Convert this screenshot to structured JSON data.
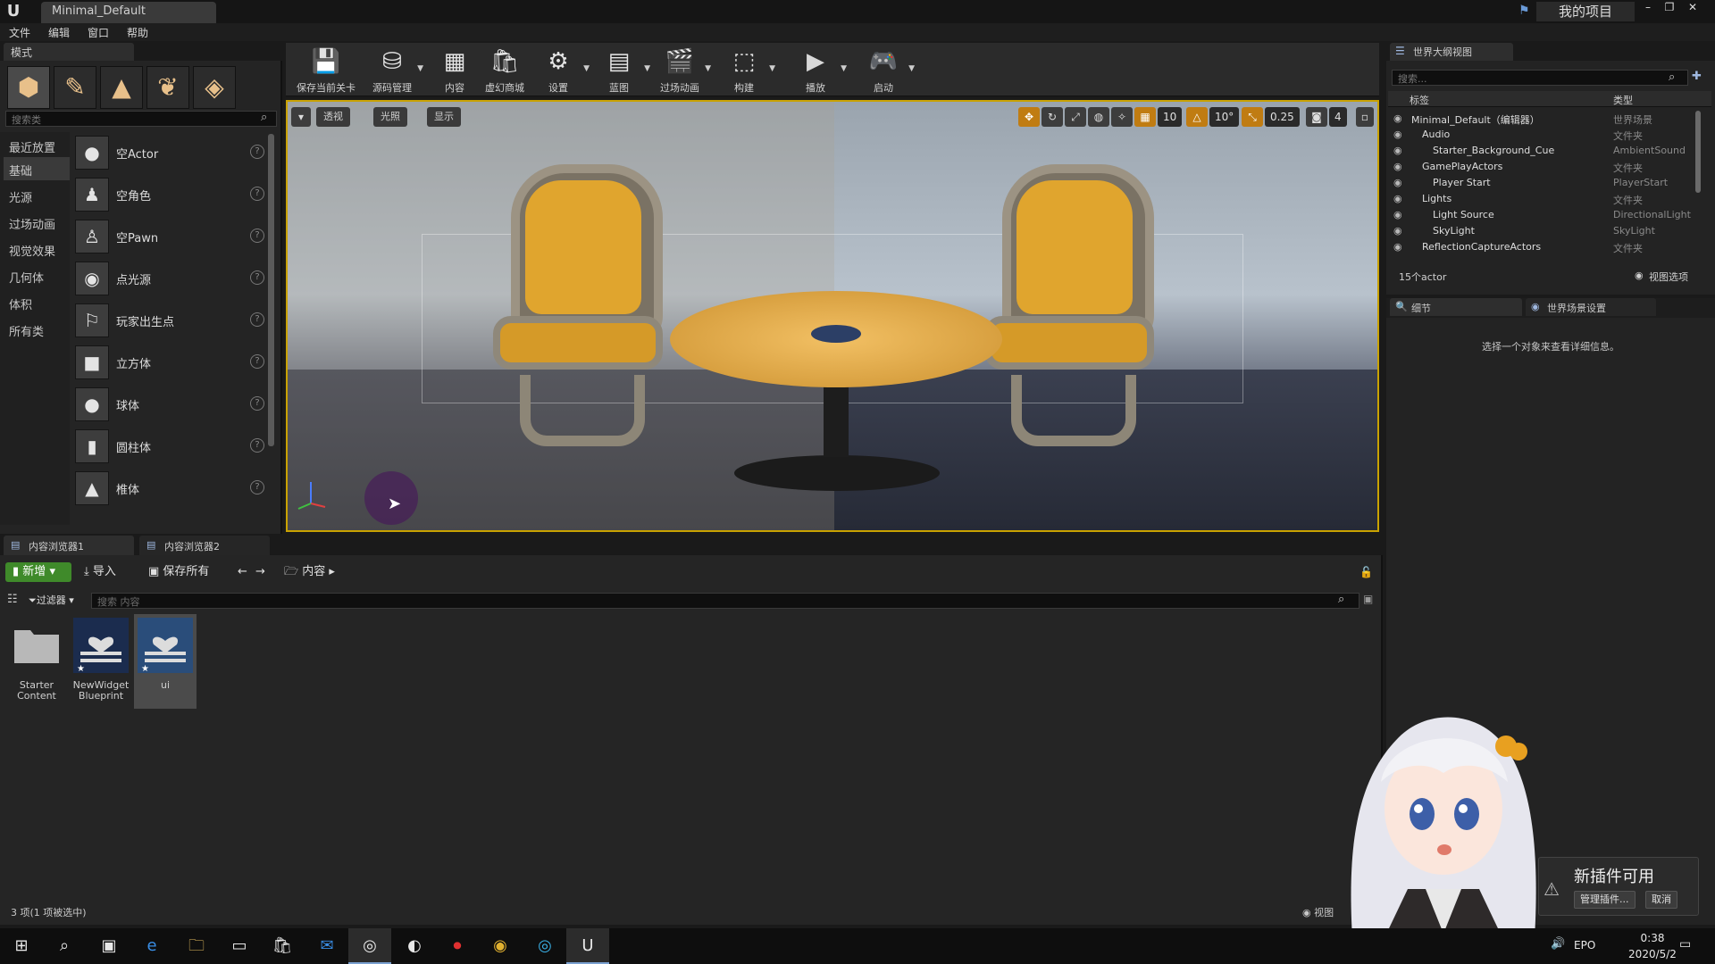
{
  "window": {
    "tab_title": "Minimal_Default",
    "my_project": "我的项目"
  },
  "menu": [
    "文件",
    "编辑",
    "窗口",
    "帮助"
  ],
  "modes": {
    "tab": "模式",
    "search_placeholder": "搜索类",
    "categories": [
      "最近放置",
      "基础",
      "光源",
      "过场动画",
      "视觉效果",
      "几何体",
      "体积",
      "所有类"
    ],
    "active_category": "基础",
    "items": [
      "空Actor",
      "空角色",
      "空Pawn",
      "点光源",
      "玩家出生点",
      "立方体",
      "球体",
      "圆柱体",
      "椎体"
    ]
  },
  "toolbar": {
    "buttons": [
      {
        "label": "保存当前关卡",
        "icon": "save-icon"
      },
      {
        "label": "源码管理",
        "icon": "source-control-icon"
      },
      {
        "label": "内容",
        "icon": "content-icon"
      },
      {
        "label": "虚幻商城",
        "icon": "marketplace-icon"
      },
      {
        "label": "设置",
        "icon": "settings-icon"
      },
      {
        "label": "蓝图",
        "icon": "blueprint-icon"
      },
      {
        "label": "过场动画",
        "icon": "cinematics-icon"
      },
      {
        "label": "构建",
        "icon": "build-icon"
      },
      {
        "label": "播放",
        "icon": "play-icon"
      },
      {
        "label": "启动",
        "icon": "launch-icon"
      }
    ]
  },
  "viewport": {
    "perspective": "透视",
    "lit": "光照",
    "show": "显示",
    "grid_snap": "10",
    "rotation_snap": "10°",
    "scale_snap": "0.25",
    "camera_speed": "4"
  },
  "outliner": {
    "tab": "世界大纲视图",
    "search_placeholder": "搜索...",
    "col_label": "标签",
    "col_type": "类型",
    "rows": [
      {
        "name": "Minimal_Default（编辑器）",
        "type": "世界场景",
        "indent": 0
      },
      {
        "name": "Audio",
        "type": "文件夹",
        "indent": 1
      },
      {
        "name": "Starter_Background_Cue",
        "type": "AmbientSound",
        "indent": 2
      },
      {
        "name": "GamePlayActors",
        "type": "文件夹",
        "indent": 1
      },
      {
        "name": "Player Start",
        "type": "PlayerStart",
        "indent": 2
      },
      {
        "name": "Lights",
        "type": "文件夹",
        "indent": 1
      },
      {
        "name": "Light Source",
        "type": "DirectionalLight",
        "indent": 2
      },
      {
        "name": "SkyLight",
        "type": "SkyLight",
        "indent": 2
      },
      {
        "name": "ReflectionCaptureActors",
        "type": "文件夹",
        "indent": 1
      }
    ],
    "actor_count": "15个actor",
    "view_options": "视图选项"
  },
  "details": {
    "tab_details": "细节",
    "tab_world": "世界场景设置",
    "empty_text": "选择一个对象来查看详细信息。"
  },
  "content_browser": {
    "tab1": "内容浏览器1",
    "tab2": "内容浏览器2",
    "new": "新增",
    "import": "导入",
    "save_all": "保存所有",
    "path": "内容",
    "filter": "过滤器",
    "search_placeholder": "搜索 内容",
    "assets": [
      {
        "label": "Starter Content",
        "kind": "folder"
      },
      {
        "label": "NewWidget Blueprint",
        "kind": "widget"
      },
      {
        "label": "ui",
        "kind": "widget"
      }
    ],
    "status": "3 项(1 项被选中)",
    "view_options": "视图"
  },
  "notification": {
    "title": "新插件可用",
    "manage": "管理插件...",
    "cancel": "取消"
  },
  "taskbar": {
    "lang": "EPO",
    "time": "0:38",
    "date": "2020/5/2"
  },
  "colors": {
    "accent_yellow": "#c9a200",
    "new_button_green": "#3f8a2a",
    "snap_orange": "#c07c12"
  }
}
